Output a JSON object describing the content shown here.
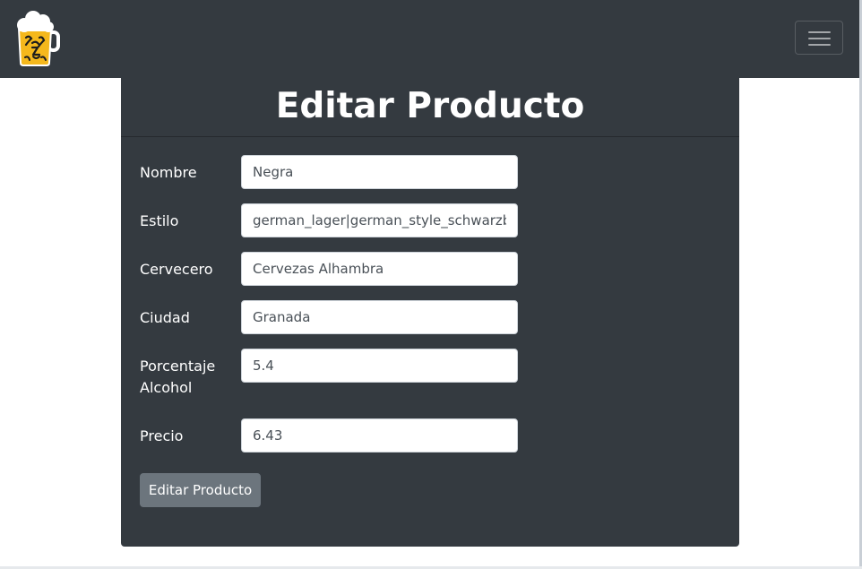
{
  "navbar": {
    "logo_icon": "beer-mug-logo",
    "toggler_icon": "hamburger-menu-icon",
    "colors": {
      "background": "#343a40"
    }
  },
  "card": {
    "title": "Editar Producto",
    "fields": [
      {
        "label": "Nombre",
        "value": "Negra"
      },
      {
        "label": "Estilo",
        "value": "german_lager|german_style_schwarzbier"
      },
      {
        "label": "Cervecero",
        "value": "Cervezas Alhambra"
      },
      {
        "label": "Ciudad",
        "value": "Granada"
      },
      {
        "label_line1": "Porcentaje",
        "label_line2": "Alcohol",
        "value": "5.4"
      },
      {
        "label": "Precio",
        "value": "6.43"
      }
    ],
    "submit_label": "Editar Producto",
    "colors": {
      "background": "#343a40",
      "button": "#6c757d"
    }
  }
}
